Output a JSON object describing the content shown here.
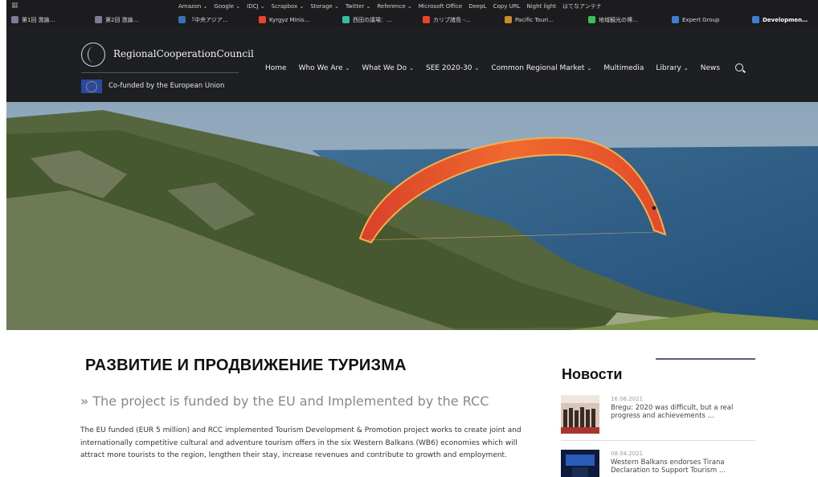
{
  "bookmarks": {
    "row1": [
      "Amazon ⌄",
      "Google ⌄",
      "IDCJ ⌄",
      "Scrapbox ⌄",
      "Storage ⌄",
      "Twitter ⌄",
      "Reference ⌄",
      "Microsoft Office",
      "DeepL",
      "Copy URL",
      "Night light",
      "はてなアンテナ"
    ],
    "tabs": [
      {
        "label": "第1回 激論…",
        "color": "#7b7b9c"
      },
      {
        "label": "第2回 激論…",
        "color": "#7b7b9c"
      },
      {
        "label": "『中央アジア…",
        "color": "#3a6fb8"
      },
      {
        "label": "Kyrgyz Minis…",
        "color": "#e8452d"
      },
      {
        "label": "西田の議場：…",
        "color": "#2fbfa0"
      },
      {
        "label": "カリブ諸島 -…",
        "color": "#e8452d"
      },
      {
        "label": "Pacific Touri…",
        "color": "#c98a2a"
      },
      {
        "label": "地域観光の博…",
        "color": "#3bbf5c"
      },
      {
        "label": "Expert Group",
        "color": "#3b7fd6"
      },
      {
        "label": "Developmen…",
        "color": "#3b7fd6"
      }
    ]
  },
  "header": {
    "logo_text": "RegionalCooperationCouncil",
    "cofunded": "Co-funded by the European Union",
    "nav": [
      {
        "label": "Home",
        "dropdown": false
      },
      {
        "label": "Who We Are",
        "dropdown": true
      },
      {
        "label": "What We Do",
        "dropdown": true
      },
      {
        "label": "SEE 2020-30",
        "dropdown": true
      },
      {
        "label": "Common Regional Market",
        "dropdown": true
      },
      {
        "label": "Multimedia",
        "dropdown": false
      },
      {
        "label": "Library",
        "dropdown": true
      },
      {
        "label": "News",
        "dropdown": false
      }
    ],
    "dropdown_glyph": "⌄"
  },
  "content": {
    "title": "РАЗВИТИЕ И ПРОДВИЖЕНИЕ ТУРИЗМА",
    "subtitle_glyph": "»",
    "subtitle": "The project is funded by the EU and Implemented by the RCC",
    "body": "The EU funded (EUR 5 million) and RCC implemented Tourism Development & Promotion project works to create joint and internationally competitive cultural and adventure tourism offers in the six Western Balkans (WB6) economies which will attract more tourists to the region, lengthen their stay, increase revenues and contribute to growth and employment."
  },
  "news": {
    "heading": "Новости",
    "items": [
      {
        "date": "16.06.2021",
        "title": "Bregu: 2020 was difficult, but a real progress and achievements ..."
      },
      {
        "date": "08.04.2021",
        "title": "Western Balkans endorses Tirana Declaration to Support Tourism ..."
      }
    ]
  },
  "colors": {
    "header_bg": "#1e1f22",
    "accent_rule": "#555f7f",
    "paraglider": "#e8532a"
  }
}
